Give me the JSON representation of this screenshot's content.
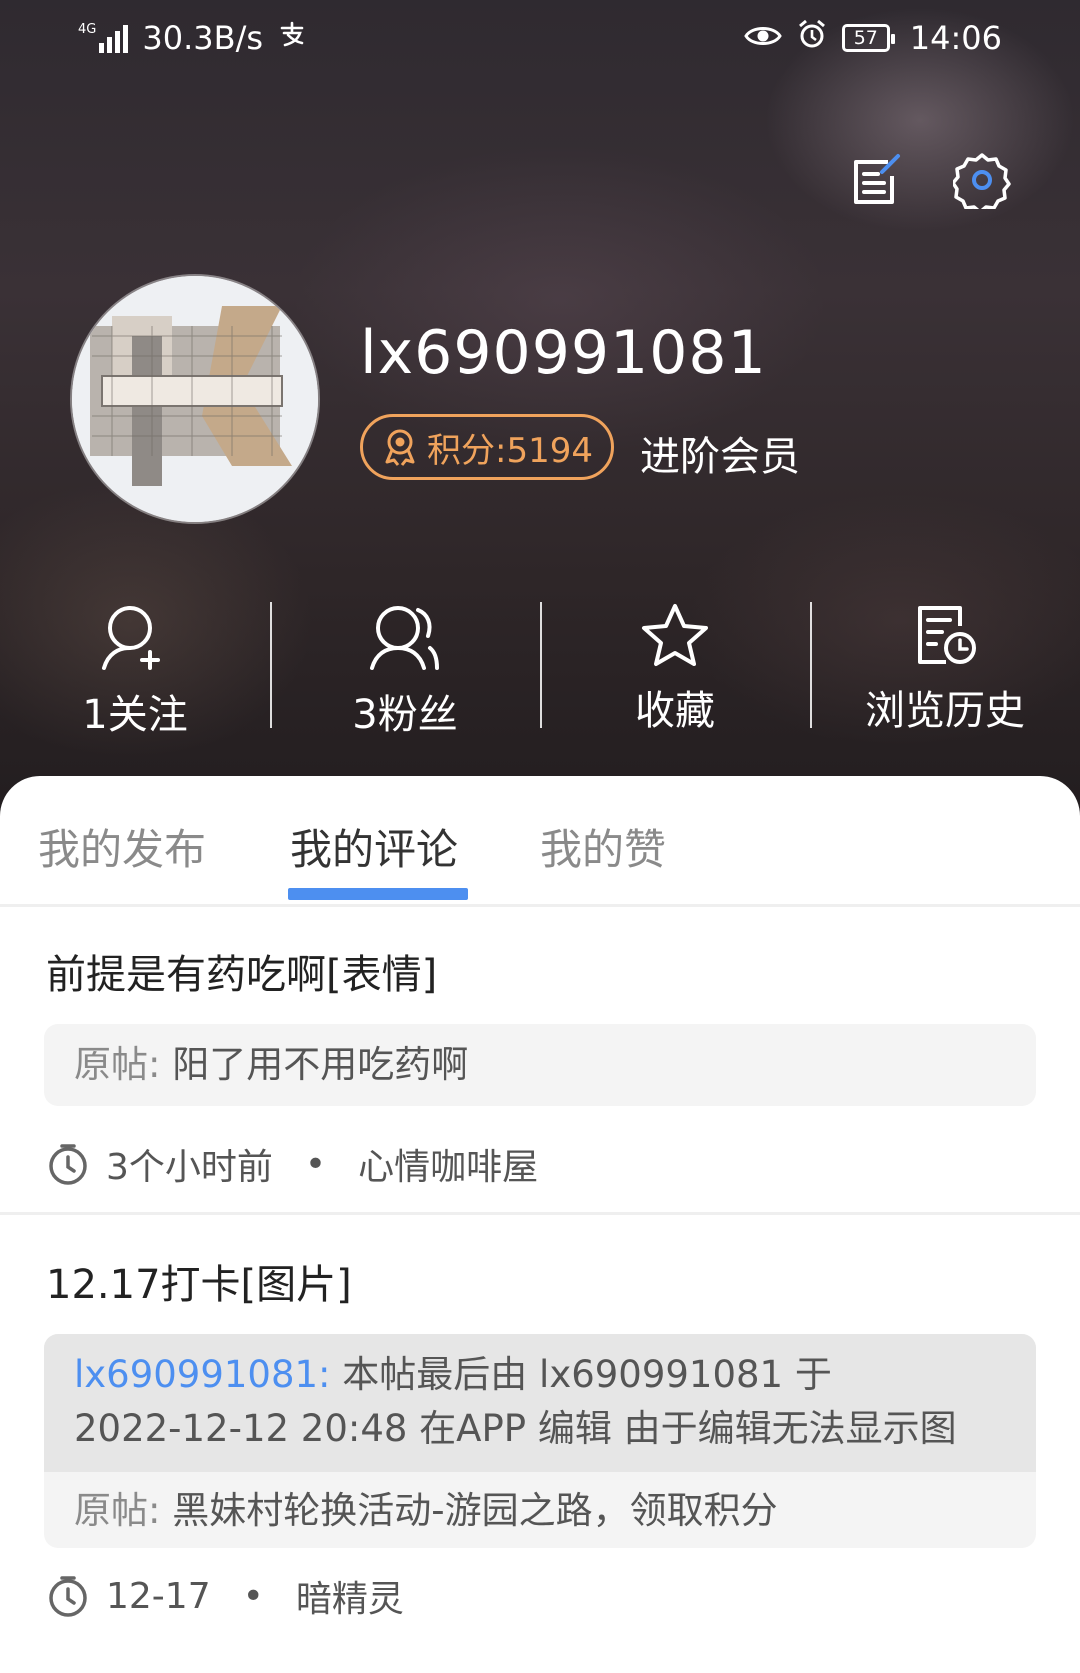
{
  "status_bar": {
    "network": "4G",
    "speed": "30.3B/s",
    "battery": "57",
    "time": "14:06"
  },
  "profile": {
    "username": "lx690991081",
    "points": "积分:5194",
    "level": "进阶会员"
  },
  "stats": [
    {
      "label": "1关注",
      "icon": "follow-icon"
    },
    {
      "label": "3粉丝",
      "icon": "fans-icon"
    },
    {
      "label": "收藏",
      "icon": "star-icon"
    },
    {
      "label": "浏览历史",
      "icon": "history-icon"
    }
  ],
  "tabs": [
    {
      "label": "我的发布"
    },
    {
      "label": "我的评论",
      "active": true
    },
    {
      "label": "我的赞"
    }
  ],
  "comments": [
    {
      "title": "前提是有药吃啊[表情]",
      "original_key": "原帖:",
      "original": "阳了用不用吃药啊",
      "time": "3个小时前",
      "board": "心情咖啡屋"
    },
    {
      "title": "12.17打卡[图片]",
      "edit_user": "lx690991081:",
      "edit_line1": "本帖最后由 lx690991081 于",
      "edit_line2": "2022-12-12 20:48 在APP 编辑 由于编辑无法显示图",
      "original_key": "原帖:",
      "original": "黑妹村轮换活动-游园之路，领取积分",
      "time": "12-17",
      "board": "暗精灵"
    }
  ],
  "colors": {
    "accent": "#4d8ff0",
    "points": "#f0a35c"
  }
}
